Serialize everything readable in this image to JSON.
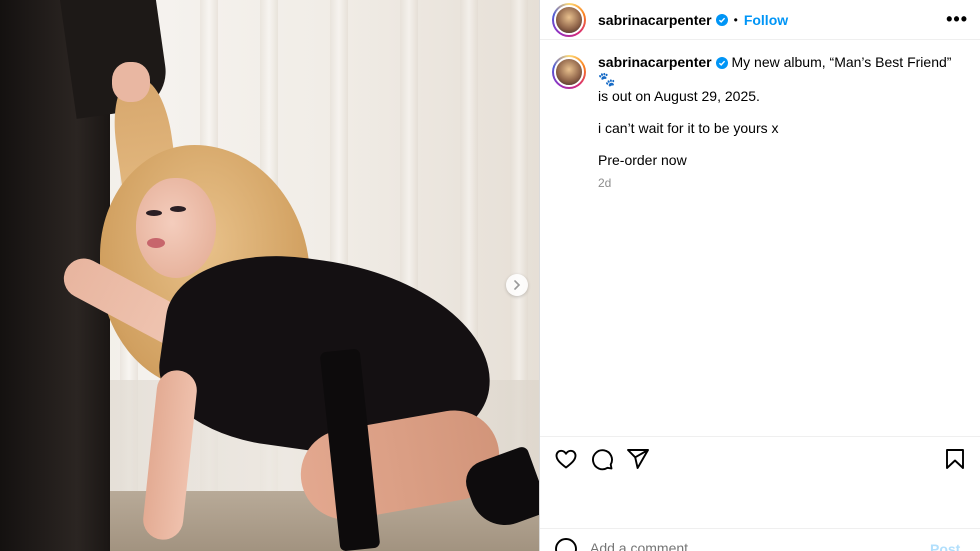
{
  "post": {
    "username": "sabrinacarpenter",
    "separator": "•",
    "follow_label": "Follow",
    "more_label": "•••"
  },
  "caption": {
    "username": "sabrinacarpenter",
    "line1": "My new album, “Man’s Best Friend”",
    "line1_emoji": "🐾",
    "line2": "is out on August 29, 2025.",
    "line3": "i can’t wait for it to be yours x",
    "line4": "Pre-order now",
    "timestamp": "2d"
  },
  "comment": {
    "placeholder": "Add a comment...",
    "post_label": "Post"
  },
  "icons": {
    "like": "heart-icon",
    "comment": "comment-icon",
    "share": "share-icon",
    "save": "bookmark-icon",
    "emoji": "emoji-icon",
    "verified": "verified-icon",
    "next": "chevron-right-icon"
  },
  "colors": {
    "accent": "#0095f6",
    "verified": "#0095f6",
    "muted": "#8e8e8e"
  }
}
